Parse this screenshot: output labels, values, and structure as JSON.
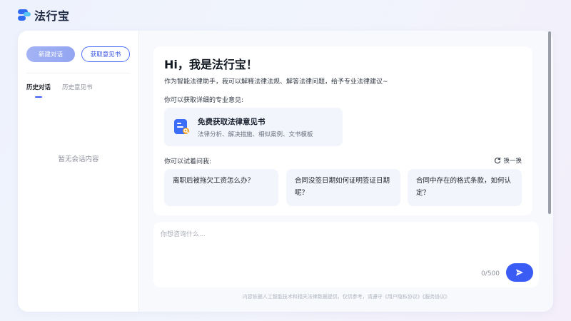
{
  "app": {
    "brand_name": "法行宝"
  },
  "sidebar": {
    "new_chat_label": "新建对话",
    "get_opinion_label": "获取意见书",
    "tabs": [
      {
        "label": "历史对话",
        "active": true
      },
      {
        "label": "历史意见书",
        "active": false
      }
    ],
    "empty_text": "暂无会话内容"
  },
  "welcome": {
    "greeting": "Hi，我是法行宝！",
    "intro": "作为智能法律助手，我可以解释法律法规、解答法律问题，给予专业法律建议~",
    "opinion_section_label": "你可以获取详细的专业意见:",
    "feature": {
      "title": "免费获取法律意见书",
      "subtitle": "法律分析、解决措施、相似案例、文书模板",
      "icon": "document-search-icon"
    },
    "questions_section_label": "你可以试着问我:",
    "refresh_label": "换一换",
    "questions": [
      "离职后被拖欠工资怎么办？",
      "合同没签日期如何证明签证日期呢？",
      "合同中存在的格式条款，如何认定？"
    ]
  },
  "input": {
    "placeholder": "你想咨询什么...",
    "counter": "0/500"
  },
  "footer": {
    "disclaimer": "内容依据人工智能技术和相关法律数据提供，仅供参考，请遵守《用户隐私协议》《服务协议》"
  },
  "colors": {
    "accent": "#3b5bf5",
    "button_light": "#a3b3f4",
    "card_bg": "#f2f5fc"
  }
}
